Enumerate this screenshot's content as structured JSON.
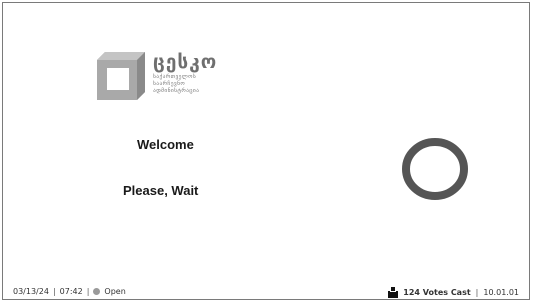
{
  "logo": {
    "title": "ცესკო",
    "subtitle_lines": [
      "საქართველოს",
      "საარჩევნო",
      "ადმინისტრაცია"
    ]
  },
  "main": {
    "welcome": "Welcome",
    "status_message": "Please, Wait"
  },
  "footer": {
    "date": "03/13/24",
    "time": "07:42",
    "status": "Open",
    "separator": "|",
    "votes_cast": "124 Votes Cast",
    "version": "10.01.01"
  },
  "colors": {
    "spinner": "#555555",
    "logo_dark": "#6a6a6a",
    "logo_light": "#a9a9a9",
    "status_dot": "#9a9a9a"
  }
}
